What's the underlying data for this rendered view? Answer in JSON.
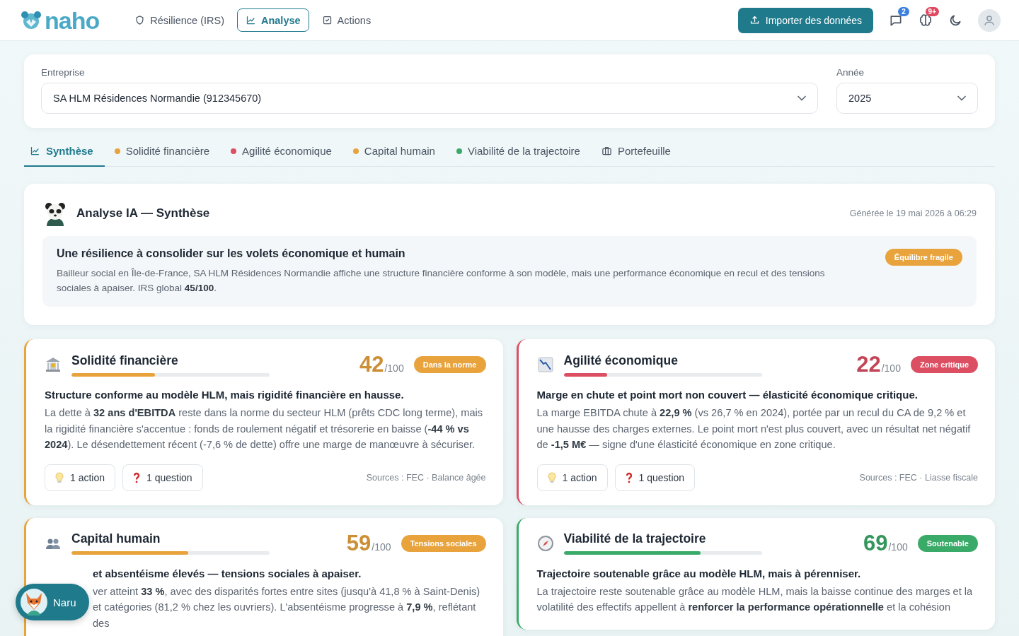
{
  "brand": {
    "name": "naho"
  },
  "nav": [
    {
      "label": "Résilience (IRS)",
      "selected": false
    },
    {
      "label": "Analyse",
      "selected": true
    },
    {
      "label": "Actions",
      "selected": false
    }
  ],
  "import_button": {
    "label": "Importer des données"
  },
  "header_icons": [
    {
      "kind": "chat",
      "badge": "2",
      "color": "#3b7fe0"
    },
    {
      "kind": "brain",
      "badge": "9+",
      "color": "#e0485f"
    },
    {
      "kind": "moon"
    },
    {
      "kind": "avatar"
    }
  ],
  "company": {
    "label": "Entreprise",
    "value": "SA HLM Résidences Normandie (912345670)"
  },
  "year": {
    "label": "Année",
    "value": "2025"
  },
  "tabs": [
    {
      "label": "Synthèse",
      "kind": "icon",
      "selected": true
    },
    {
      "label": "Solidité financière",
      "kind": "dot",
      "color": "#e8a33d",
      "selected": false
    },
    {
      "label": "Agilité économique",
      "kind": "dot",
      "color": "#dc4f63",
      "selected": false
    },
    {
      "label": "Capital humain",
      "kind": "dot",
      "color": "#e8a33d",
      "selected": false
    },
    {
      "label": "Viabilité de la trajectoire",
      "kind": "dot",
      "color": "#3aaa68",
      "selected": false
    },
    {
      "label": "Portefeuille",
      "kind": "icon",
      "selected": false
    }
  ],
  "synthesis": {
    "title": "Analyse IA — Synthèse",
    "generated": "Générée le 19 mai 2026 à 06:29",
    "headline": "Une résilience à consolider sur les volets économique et humain",
    "text": "Bailleur social en Île-de-France, SA HLM Résidences Normandie affiche une structure financière conforme à son modèle, mais une performance économique en recul et des tensions sociales à apaiser. IRS global **45/100**.",
    "badge": "Équilibre fragile"
  },
  "cards": [
    {
      "title": "Solidité financière",
      "score": "42",
      "scale": "/100",
      "level": 0.42,
      "color": "#e8a33d",
      "status": "Dans la norme",
      "lead": "Structure conforme au modèle HLM, mais rigidité financière en hausse.",
      "text": "La dette à **32 ans d'EBITDA** reste dans la norme du secteur HLM (prêts CDC long terme), mais la rigidité financière s'accentue : fonds de roulement négatif et trésorerie en baisse (**-44 % vs 2024**). Le désendettement récent (-7,6 % de dette) offre une marge de manœuvre à sécuriser.",
      "chips": [
        {
          "kind": "action",
          "label": "1 action"
        },
        {
          "kind": "question",
          "label": "1 question"
        }
      ],
      "sources": "Sources : FEC · Balance âgée"
    },
    {
      "title": "Agilité économique",
      "score": "22",
      "scale": "/100",
      "level": 0.22,
      "color": "#dc4f63",
      "status": "Zone critique",
      "lead": "Marge en chute et point mort non couvert — élasticité économique critique.",
      "text": "La marge EBITDA chute à **22,9 %** (vs 26,7 % en 2024), portée par un recul du CA de 9,2 % et une hausse des charges externes. Le point mort n'est plus couvert, avec un résultat net négatif de **-1,5 M€** — signe d'une élasticité économique en zone critique.",
      "chips": [
        {
          "kind": "action",
          "label": "1 action"
        },
        {
          "kind": "question",
          "label": "1 question"
        }
      ],
      "sources": "Sources : FEC · Liasse fiscale"
    },
    {
      "title": "Capital humain",
      "score": "59",
      "scale": "/100",
      "level": 0.59,
      "color": "#e8a33d",
      "status": "Tensions sociales",
      "lead": "et absentéisme élevés — tensions sociales à apaiser.",
      "text": "ver atteint **33 %**, avec des disparités fortes entre sites (jusqu'à 41,8 % à Saint-Denis) et catégories (81,2 % chez les ouvriers). L'absentéisme progresse à **7,9 %**, reflétant des"
    },
    {
      "title": "Viabilité de la trajectoire",
      "score": "69",
      "scale": "/100",
      "level": 0.69,
      "color": "#3aaa68",
      "status": "Soutenable",
      "lead": "Trajectoire soutenable grâce au modèle HLM, mais à pérenniser.",
      "text": "La trajectoire reste soutenable grâce au modèle HLM, mais la baisse continue des marges et la volatilité des effectifs appellent à **renforcer la performance opérationnelle** et la cohésion"
    }
  ],
  "assistant": {
    "label": "Naru"
  }
}
